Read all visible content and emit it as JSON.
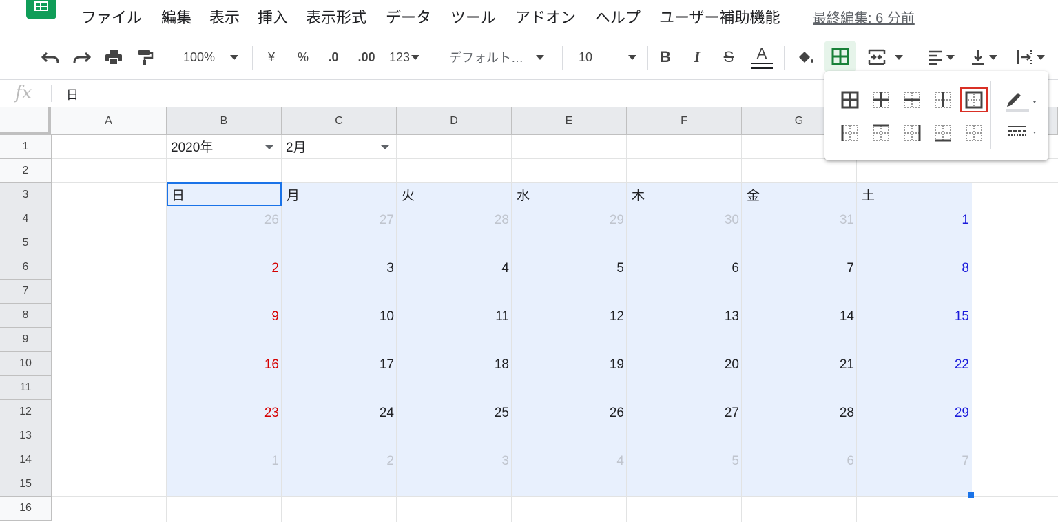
{
  "menu": {
    "items": [
      "ファイル",
      "編集",
      "表示",
      "挿入",
      "表示形式",
      "データ",
      "ツール",
      "アドオン",
      "ヘルプ",
      "ユーザー補助機能"
    ],
    "last_edit": "最終編集: 6 分前"
  },
  "toolbar": {
    "zoom": "100%",
    "currency": "¥",
    "percent": "%",
    "decrease_decimal": ".0",
    "increase_decimal": ".00",
    "more_formats": "123",
    "font": "デフォルト…",
    "font_size": "10",
    "bold": "B",
    "italic": "I",
    "strike": "S",
    "text_color": "A"
  },
  "formula_bar": {
    "fx": "fx",
    "value": "日"
  },
  "columns": [
    "A",
    "B",
    "C",
    "D",
    "E",
    "F",
    "G"
  ],
  "rows": [
    "1",
    "2",
    "3",
    "4",
    "5",
    "6",
    "7",
    "8",
    "9",
    "10",
    "11",
    "12",
    "13",
    "14",
    "15",
    "16"
  ],
  "cells": {
    "year": "2020年",
    "month": "2月",
    "weekdays": [
      "日",
      "月",
      "火",
      "水",
      "木",
      "金",
      "土"
    ]
  },
  "calendar": {
    "weeks": [
      [
        "26",
        "27",
        "28",
        "29",
        "30",
        "31",
        "1"
      ],
      [
        "2",
        "3",
        "4",
        "5",
        "6",
        "7",
        "8"
      ],
      [
        "9",
        "10",
        "11",
        "12",
        "13",
        "14",
        "15"
      ],
      [
        "16",
        "17",
        "18",
        "19",
        "20",
        "21",
        "22"
      ],
      [
        "23",
        "24",
        "25",
        "26",
        "27",
        "28",
        "29"
      ],
      [
        "1",
        "2",
        "3",
        "4",
        "5",
        "6",
        "7"
      ]
    ],
    "out_of_month": [
      [
        true,
        true,
        true,
        true,
        true,
        true,
        false
      ],
      [
        false,
        false,
        false,
        false,
        false,
        false,
        false
      ],
      [
        false,
        false,
        false,
        false,
        false,
        false,
        false
      ],
      [
        false,
        false,
        false,
        false,
        false,
        false,
        false
      ],
      [
        false,
        false,
        false,
        false,
        false,
        false,
        false
      ],
      [
        true,
        true,
        true,
        true,
        true,
        true,
        true
      ]
    ]
  },
  "colors": {
    "sunday": "#d50000",
    "saturday": "#1a1adb",
    "weekday": "#202124",
    "out_of_month": "#c0c5ce",
    "selection_fill": "#e8f0fd",
    "accent": "#1a73e8",
    "sheets_green": "#0f9d58"
  },
  "border_popup": {
    "options": [
      "all-borders",
      "inner-borders",
      "horizontal-borders",
      "vertical-borders",
      "outer-borders",
      "left-border",
      "top-border",
      "right-border",
      "bottom-border",
      "clear-borders"
    ],
    "selected": "outer-borders"
  }
}
